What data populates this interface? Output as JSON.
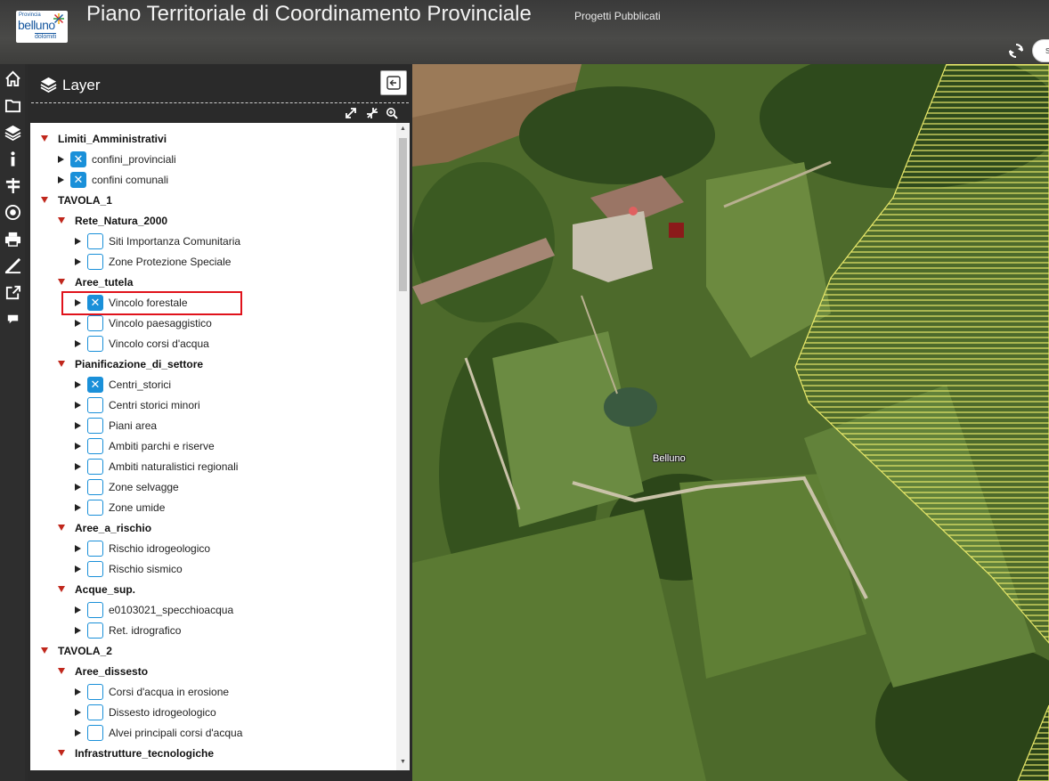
{
  "header": {
    "logo": {
      "line1": "Provincia",
      "line2": "belluno",
      "line3": "dolomiti"
    },
    "title": "Piano Territoriale di Coordinamento Provinciale",
    "subtitle": "Progetti Pubblicati",
    "search_placeholder": "s"
  },
  "toolbar": {
    "items": [
      "home-icon",
      "folder-icon",
      "layers-icon",
      "info-icon",
      "signpost-icon",
      "target-icon",
      "print-icon",
      "ruler-icon",
      "share-icon",
      "comment-icon"
    ]
  },
  "panel": {
    "title": "Layer",
    "tree": [
      {
        "level": 0,
        "label": "Limiti_Amministrativi",
        "type": "group"
      },
      {
        "level": 1,
        "label": "confini_provinciali",
        "type": "layer",
        "checked": true
      },
      {
        "level": 1,
        "label": "confini comunali",
        "type": "layer",
        "checked": true
      },
      {
        "level": 0,
        "label": "TAVOLA_1",
        "type": "group"
      },
      {
        "level": 1,
        "label": "Rete_Natura_2000",
        "type": "group"
      },
      {
        "level": 2,
        "label": "Siti Importanza Comunitaria",
        "type": "layer",
        "checked": false
      },
      {
        "level": 2,
        "label": "Zone Protezione Speciale",
        "type": "layer",
        "checked": false
      },
      {
        "level": 1,
        "label": "Aree_tutela",
        "type": "group"
      },
      {
        "level": 2,
        "label": "Vincolo forestale",
        "type": "layer",
        "checked": true
      },
      {
        "level": 2,
        "label": "Vincolo paesaggistico",
        "type": "layer",
        "checked": false
      },
      {
        "level": 2,
        "label": "Vincolo corsi d'acqua",
        "type": "layer",
        "checked": false
      },
      {
        "level": 1,
        "label": "Pianificazione_di_settore",
        "type": "group"
      },
      {
        "level": 2,
        "label": "Centri_storici",
        "type": "layer",
        "checked": true
      },
      {
        "level": 2,
        "label": "Centri storici minori",
        "type": "layer",
        "checked": false
      },
      {
        "level": 2,
        "label": "Piani area",
        "type": "layer",
        "checked": false
      },
      {
        "level": 2,
        "label": "Ambiti parchi e riserve",
        "type": "layer",
        "checked": false
      },
      {
        "level": 2,
        "label": "Ambiti naturalistici regionali",
        "type": "layer",
        "checked": false
      },
      {
        "level": 2,
        "label": "Zone selvagge",
        "type": "layer",
        "checked": false
      },
      {
        "level": 2,
        "label": "Zone umide",
        "type": "layer",
        "checked": false
      },
      {
        "level": 1,
        "label": "Aree_a_rischio",
        "type": "group"
      },
      {
        "level": 2,
        "label": "Rischio idrogeologico",
        "type": "layer",
        "checked": false
      },
      {
        "level": 2,
        "label": "Rischio sismico",
        "type": "layer",
        "checked": false
      },
      {
        "level": 1,
        "label": "Acque_sup.",
        "type": "group"
      },
      {
        "level": 2,
        "label": "e0103021_specchioacqua",
        "type": "layer",
        "checked": false
      },
      {
        "level": 2,
        "label": "Ret. idrografico",
        "type": "layer",
        "checked": false
      },
      {
        "level": 0,
        "label": "TAVOLA_2",
        "type": "group"
      },
      {
        "level": 1,
        "label": "Aree_dissesto",
        "type": "group"
      },
      {
        "level": 2,
        "label": "Corsi d'acqua in erosione",
        "type": "layer",
        "checked": false
      },
      {
        "level": 2,
        "label": "Dissesto idrogeologico",
        "type": "layer",
        "checked": false
      },
      {
        "level": 2,
        "label": "Alvei principali corsi d'acqua",
        "type": "layer",
        "checked": false
      },
      {
        "level": 1,
        "label": "Infrastrutture_tecnologiche",
        "type": "group"
      }
    ],
    "highlighted": "Vincolo forestale"
  },
  "map": {
    "place_label": "Belluno",
    "hatch_color": "#e8e86a",
    "marker_color": "#8b1a1a"
  }
}
